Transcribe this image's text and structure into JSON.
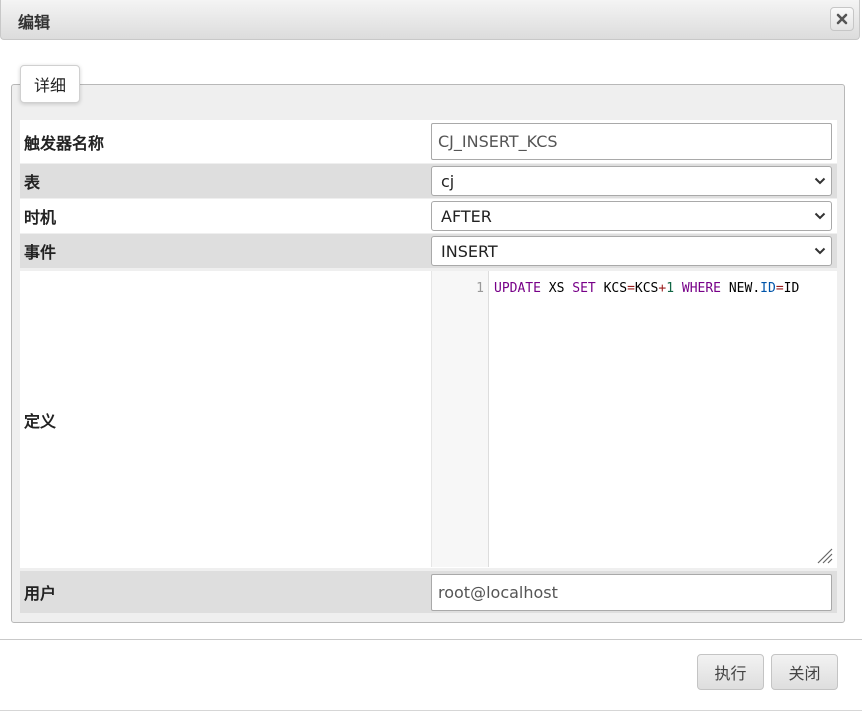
{
  "dialog": {
    "title": "编辑",
    "close_icon": "close-icon"
  },
  "fieldset": {
    "legend": "详细"
  },
  "form": {
    "trigger_name": {
      "label": "触发器名称",
      "value": "CJ_INSERT_KCS"
    },
    "table": {
      "label": "表",
      "value": "cj"
    },
    "timing": {
      "label": "时机",
      "value": "AFTER"
    },
    "event": {
      "label": "事件",
      "value": "INSERT"
    },
    "definition": {
      "label": "定义",
      "line_number": "1",
      "tokens": {
        "update": "UPDATE",
        "xs": " XS ",
        "set": "SET",
        "kcs1": " KCS",
        "eq1": "=",
        "kcs2": "KCS",
        "plus": "+",
        "one": "1",
        "where": "WHERE",
        "new": " NEW.",
        "id_prop": "ID",
        "eq2": "=",
        "id": "ID"
      }
    },
    "user": {
      "label": "用户",
      "value": "root@localhost"
    }
  },
  "footer": {
    "execute_label": "执行",
    "close_label": "关闭"
  }
}
